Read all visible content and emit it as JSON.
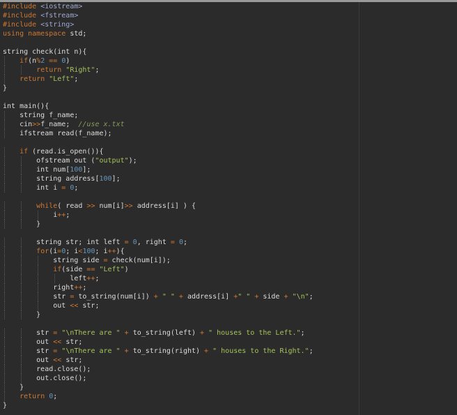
{
  "editor": {
    "lines": [
      [
        {
          "t": "pre",
          "s": "#include "
        },
        {
          "t": "header",
          "s": "<iostream>"
        }
      ],
      [
        {
          "t": "pre",
          "s": "#include "
        },
        {
          "t": "header",
          "s": "<fstream>"
        }
      ],
      [
        {
          "t": "pre",
          "s": "#include "
        },
        {
          "t": "header",
          "s": "<string>"
        }
      ],
      [
        {
          "t": "kw",
          "s": "using namespace"
        },
        {
          "t": "default",
          "s": " std;"
        }
      ],
      [],
      [
        {
          "t": "default",
          "s": "string check(int n){"
        }
      ],
      [
        {
          "t": "default",
          "s": "    "
        },
        {
          "t": "kw",
          "s": "if"
        },
        {
          "t": "default",
          "s": "(n"
        },
        {
          "t": "op",
          "s": "%"
        },
        {
          "t": "num",
          "s": "2"
        },
        {
          "t": "default",
          "s": " "
        },
        {
          "t": "op",
          "s": "=="
        },
        {
          "t": "default",
          "s": " "
        },
        {
          "t": "num",
          "s": "0"
        },
        {
          "t": "default",
          "s": ")"
        }
      ],
      [
        {
          "t": "default",
          "s": "        "
        },
        {
          "t": "kw",
          "s": "return"
        },
        {
          "t": "default",
          "s": " "
        },
        {
          "t": "str",
          "s": "\"Right\""
        },
        {
          "t": "default",
          "s": ";"
        }
      ],
      [
        {
          "t": "default",
          "s": "    "
        },
        {
          "t": "kw",
          "s": "return"
        },
        {
          "t": "default",
          "s": " "
        },
        {
          "t": "str",
          "s": "\"Left\""
        },
        {
          "t": "default",
          "s": ";"
        }
      ],
      [
        {
          "t": "default",
          "s": "}"
        }
      ],
      [],
      [
        {
          "t": "default",
          "s": "int main(){"
        }
      ],
      [
        {
          "t": "default",
          "s": "    string f_name;"
        }
      ],
      [
        {
          "t": "default",
          "s": "    cin"
        },
        {
          "t": "op",
          "s": ">>"
        },
        {
          "t": "default",
          "s": "f_name;  "
        },
        {
          "t": "cmt",
          "s": "//use x.txt"
        }
      ],
      [
        {
          "t": "default",
          "s": "    ifstream read(f_name);"
        }
      ],
      [],
      [
        {
          "t": "default",
          "s": "    "
        },
        {
          "t": "kw",
          "s": "if"
        },
        {
          "t": "default",
          "s": " (read.is_open()){"
        }
      ],
      [
        {
          "t": "default",
          "s": "        ofstream out ("
        },
        {
          "t": "str",
          "s": "\"output\""
        },
        {
          "t": "default",
          "s": ");"
        }
      ],
      [
        {
          "t": "default",
          "s": "        int num["
        },
        {
          "t": "num",
          "s": "100"
        },
        {
          "t": "default",
          "s": "];"
        }
      ],
      [
        {
          "t": "default",
          "s": "        string address["
        },
        {
          "t": "num",
          "s": "100"
        },
        {
          "t": "default",
          "s": "];"
        }
      ],
      [
        {
          "t": "default",
          "s": "        int i "
        },
        {
          "t": "op",
          "s": "="
        },
        {
          "t": "default",
          "s": " "
        },
        {
          "t": "num",
          "s": "0"
        },
        {
          "t": "default",
          "s": ";"
        }
      ],
      [],
      [
        {
          "t": "default",
          "s": "        "
        },
        {
          "t": "kw",
          "s": "while"
        },
        {
          "t": "default",
          "s": "( read "
        },
        {
          "t": "op",
          "s": ">>"
        },
        {
          "t": "default",
          "s": " num[i]"
        },
        {
          "t": "op",
          "s": ">>"
        },
        {
          "t": "default",
          "s": " address[i] ) {"
        }
      ],
      [
        {
          "t": "default",
          "s": "            i"
        },
        {
          "t": "op",
          "s": "++"
        },
        {
          "t": "default",
          "s": ";"
        }
      ],
      [
        {
          "t": "default",
          "s": "        }"
        }
      ],
      [],
      [
        {
          "t": "default",
          "s": "        string str; int left "
        },
        {
          "t": "op",
          "s": "="
        },
        {
          "t": "default",
          "s": " "
        },
        {
          "t": "num",
          "s": "0"
        },
        {
          "t": "default",
          "s": ", right "
        },
        {
          "t": "op",
          "s": "="
        },
        {
          "t": "default",
          "s": " "
        },
        {
          "t": "num",
          "s": "0"
        },
        {
          "t": "default",
          "s": ";"
        }
      ],
      [
        {
          "t": "default",
          "s": "        "
        },
        {
          "t": "kw",
          "s": "for"
        },
        {
          "t": "default",
          "s": "(i"
        },
        {
          "t": "op",
          "s": "="
        },
        {
          "t": "num",
          "s": "0"
        },
        {
          "t": "default",
          "s": "; i"
        },
        {
          "t": "op",
          "s": "<"
        },
        {
          "t": "num",
          "s": "100"
        },
        {
          "t": "default",
          "s": "; i"
        },
        {
          "t": "op",
          "s": "++"
        },
        {
          "t": "default",
          "s": "){"
        }
      ],
      [
        {
          "t": "default",
          "s": "            string side "
        },
        {
          "t": "op",
          "s": "="
        },
        {
          "t": "default",
          "s": " check(num[i]);"
        }
      ],
      [
        {
          "t": "default",
          "s": "            "
        },
        {
          "t": "kw",
          "s": "if"
        },
        {
          "t": "default",
          "s": "(side "
        },
        {
          "t": "op",
          "s": "=="
        },
        {
          "t": "default",
          "s": " "
        },
        {
          "t": "str",
          "s": "\"Left\""
        },
        {
          "t": "default",
          "s": ")"
        }
      ],
      [
        {
          "t": "default",
          "s": "                left"
        },
        {
          "t": "op",
          "s": "++"
        },
        {
          "t": "default",
          "s": ";"
        }
      ],
      [
        {
          "t": "default",
          "s": "            right"
        },
        {
          "t": "op",
          "s": "++"
        },
        {
          "t": "default",
          "s": ";"
        }
      ],
      [
        {
          "t": "default",
          "s": "            str "
        },
        {
          "t": "op",
          "s": "="
        },
        {
          "t": "default",
          "s": " to_string(num[i]) "
        },
        {
          "t": "op",
          "s": "+"
        },
        {
          "t": "default",
          "s": " "
        },
        {
          "t": "str",
          "s": "\" \""
        },
        {
          "t": "default",
          "s": " "
        },
        {
          "t": "op",
          "s": "+"
        },
        {
          "t": "default",
          "s": " address[i] "
        },
        {
          "t": "op",
          "s": "+"
        },
        {
          "t": "str",
          "s": "\" \""
        },
        {
          "t": "default",
          "s": " "
        },
        {
          "t": "op",
          "s": "+"
        },
        {
          "t": "default",
          "s": " side "
        },
        {
          "t": "op",
          "s": "+"
        },
        {
          "t": "default",
          "s": " "
        },
        {
          "t": "str",
          "s": "\"\\n\""
        },
        {
          "t": "default",
          "s": ";"
        }
      ],
      [
        {
          "t": "default",
          "s": "            out "
        },
        {
          "t": "op",
          "s": "<<"
        },
        {
          "t": "default",
          "s": " str;"
        }
      ],
      [
        {
          "t": "default",
          "s": "        }"
        }
      ],
      [],
      [
        {
          "t": "default",
          "s": "        str "
        },
        {
          "t": "op",
          "s": "="
        },
        {
          "t": "default",
          "s": " "
        },
        {
          "t": "str",
          "s": "\"\\nThere are \""
        },
        {
          "t": "default",
          "s": " "
        },
        {
          "t": "op",
          "s": "+"
        },
        {
          "t": "default",
          "s": " to_string(left) "
        },
        {
          "t": "op",
          "s": "+"
        },
        {
          "t": "default",
          "s": " "
        },
        {
          "t": "str",
          "s": "\" houses to the Left.\""
        },
        {
          "t": "default",
          "s": ";"
        }
      ],
      [
        {
          "t": "default",
          "s": "        out "
        },
        {
          "t": "op",
          "s": "<<"
        },
        {
          "t": "default",
          "s": " str;"
        }
      ],
      [
        {
          "t": "default",
          "s": "        str "
        },
        {
          "t": "op",
          "s": "="
        },
        {
          "t": "default",
          "s": " "
        },
        {
          "t": "str",
          "s": "\"\\nThere are \""
        },
        {
          "t": "default",
          "s": " "
        },
        {
          "t": "op",
          "s": "+"
        },
        {
          "t": "default",
          "s": " to_string(right) "
        },
        {
          "t": "op",
          "s": "+"
        },
        {
          "t": "default",
          "s": " "
        },
        {
          "t": "str",
          "s": "\" houses to the Right.\""
        },
        {
          "t": "default",
          "s": ";"
        }
      ],
      [
        {
          "t": "default",
          "s": "        out "
        },
        {
          "t": "op",
          "s": "<<"
        },
        {
          "t": "default",
          "s": " str;"
        }
      ],
      [
        {
          "t": "default",
          "s": "        read.close();"
        }
      ],
      [
        {
          "t": "default",
          "s": "        out.close();"
        }
      ],
      [
        {
          "t": "default",
          "s": "    }"
        }
      ],
      [
        {
          "t": "default",
          "s": "    "
        },
        {
          "t": "kw",
          "s": "return"
        },
        {
          "t": "default",
          "s": " "
        },
        {
          "t": "num",
          "s": "0"
        },
        {
          "t": "default",
          "s": ";"
        }
      ],
      [
        {
          "t": "default",
          "s": "}"
        }
      ]
    ]
  },
  "colors": {
    "background": "#2b2b2b",
    "default": "#dcdcdc",
    "preprocessor": "#cc7832",
    "header": "#a0a6d0",
    "keyword": "#cc7832",
    "number": "#6897bb",
    "string": "#a5c25c",
    "comment": "#8a9a5b"
  }
}
